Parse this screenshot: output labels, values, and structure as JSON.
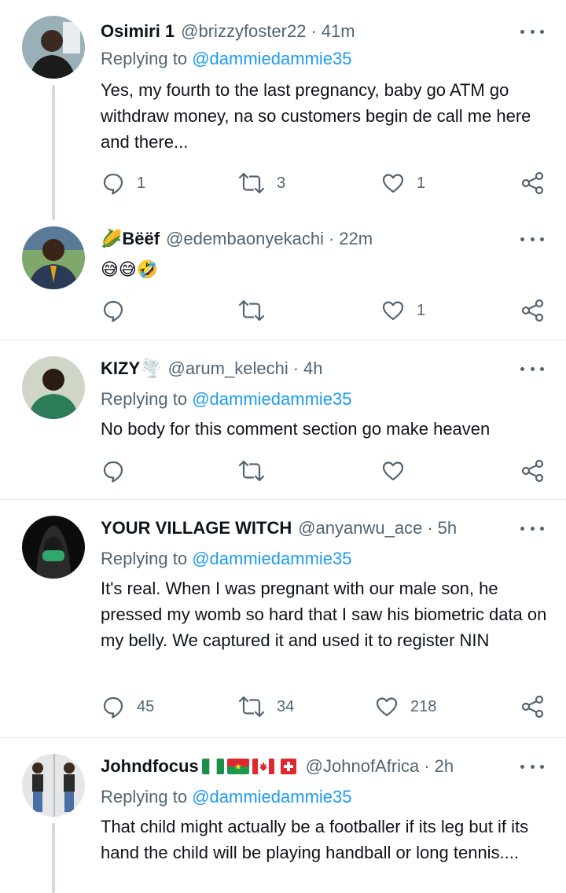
{
  "reply_prefix": "Replying to",
  "tweets": [
    {
      "name": "Osimiri 1",
      "handle": "@brizzyfoster22",
      "time": "41m",
      "reply_to": "@dammiedammie35",
      "text": "Yes, my fourth to the last pregnancy, baby go ATM go withdraw money, na so customers begin de call me here and there...",
      "replies": "1",
      "retweets": "3",
      "likes": "1"
    },
    {
      "name": "Bëëf",
      "name_emoji": "🌽",
      "handle": "@edembaonyekachi",
      "time": "22m",
      "text": "😅😅🤣",
      "replies": "",
      "retweets": "",
      "likes": "1"
    },
    {
      "name": "KIZY",
      "name_emoji": "🌪️",
      "handle": "@arum_kelechi",
      "time": "4h",
      "reply_to": "@dammiedammie35",
      "text": "No body for this comment section go make heaven",
      "replies": "",
      "retweets": "",
      "likes": ""
    },
    {
      "name": "YOUR VILLAGE WITCH",
      "handle": "@anyanwu_ace",
      "time": "5h",
      "reply_to": "@dammiedammie35",
      "text": "It's real. When I was pregnant with our male son, he pressed my womb so hard that I saw his biometric data on my belly. We captured it and used it to register NIN",
      "replies": "45",
      "retweets": "34",
      "likes": "218"
    },
    {
      "name": "Johndfocus",
      "handle": "@JohnofAfrica",
      "time": "2h",
      "reply_to": "@dammiedammie35",
      "text": "That child might actually be a footballer if its leg but if its hand the child will be playing handball or long tennis....",
      "flags": [
        "nigeria-flag",
        "burkina-faso-flag",
        "canada-flag",
        "switzerland-flag"
      ]
    }
  ],
  "icons": {
    "reply": "reply-icon",
    "retweet": "retweet-icon",
    "like": "heart-icon",
    "share": "share-icon",
    "more": "more-icon"
  },
  "colors": {
    "link": "#1d9bf0",
    "secondary": "#536471",
    "divider": "#e1e8ed",
    "thread_line": "#cfd9de"
  }
}
